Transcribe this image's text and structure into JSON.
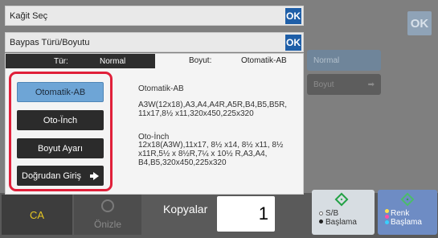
{
  "background": {
    "ok_label": "OK",
    "normal_button_label": "Normal",
    "size_button_label": "Boyut"
  },
  "headers": {
    "paper_select": {
      "title": "Kağit Seç",
      "ok_label": "OK"
    },
    "bypass": {
      "title": "Baypas Türü/Boyutu",
      "ok_label": "OK"
    }
  },
  "tabs": {
    "type": {
      "label": "Tür:",
      "value": "Normal"
    },
    "size": {
      "label": "Boyut:",
      "value": "Otomatik-AB"
    }
  },
  "options": [
    {
      "label": "Otomatik-AB",
      "selected": true
    },
    {
      "label": "Oto-Ïnch",
      "selected": false
    },
    {
      "label": "Boyut Ayarı",
      "selected": false
    },
    {
      "label": "Doğrudan Giriş",
      "selected": false,
      "icon": "arrow-right-icon"
    }
  ],
  "info": {
    "auto_ab_title": "Otomatik-AB",
    "auto_ab_sizes": "A3W(12x18),A3,A4,A4R,A5R,B4,B5,B5R, 11x17,8½ x11,320x450,225x320",
    "auto_inch_title": "Oto-İnch",
    "auto_inch_sizes": "12x18(A3W),11x17, 8½ x14, 8½ x11, 8½ x11R,5½ x 8½R,7¼ x 10½ R,A3,A4, B4,B5,320x450,225x320"
  },
  "bottom_bar": {
    "ca_label": "CA",
    "preview_label": "Önizle",
    "copies_label": "Kopyalar",
    "copies_value": "1",
    "bw_start_label_1": "S/B",
    "bw_start_label_2": "Başlama",
    "color_start_label_1": "Renk",
    "color_start_label_2": "Başlama"
  },
  "colors": {
    "accent_blue": "#1f5fa8",
    "selected_option": "#6ea5d6",
    "highlight_red": "#e0203a",
    "ca_yellow": "#e6c623",
    "start_green": "#22a144"
  }
}
